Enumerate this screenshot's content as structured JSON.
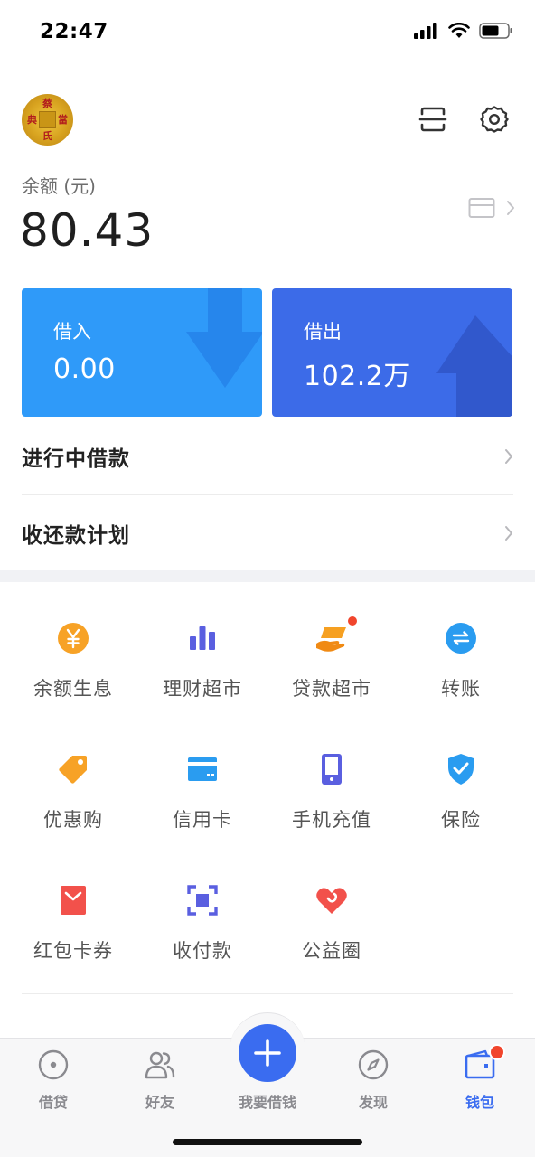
{
  "status_bar": {
    "time": "22:47"
  },
  "header": {
    "avatar_chars": [
      "蔡",
      "典",
      "當",
      "氏"
    ]
  },
  "balance": {
    "label": "余额 (元)",
    "value": "80.43"
  },
  "tiles": {
    "borrow": {
      "label": "借入",
      "value": "0.00",
      "color": "#2f9af9"
    },
    "lend": {
      "label": "借出",
      "value": "102.2万",
      "color": "#3c6be8"
    }
  },
  "list": [
    {
      "label": "进行中借款"
    },
    {
      "label": "收还款计划"
    }
  ],
  "grid": [
    {
      "label": "余额生息",
      "icon": "yen-coin-icon"
    },
    {
      "label": "理财超市",
      "icon": "bar-chart-icon"
    },
    {
      "label": "贷款超市",
      "icon": "hand-money-icon",
      "badge": true
    },
    {
      "label": "转账",
      "icon": "transfer-icon"
    },
    {
      "label": "优惠购",
      "icon": "tag-icon"
    },
    {
      "label": "信用卡",
      "icon": "credit-card-icon"
    },
    {
      "label": "手机充值",
      "icon": "phone-icon"
    },
    {
      "label": "保险",
      "icon": "shield-check-icon"
    },
    {
      "label": "红包卡券",
      "icon": "red-envelope-icon"
    },
    {
      "label": "收付款",
      "icon": "scan-icon"
    },
    {
      "label": "公益圈",
      "icon": "heart-icon"
    }
  ],
  "tab_bar": {
    "items": [
      {
        "label": "借贷",
        "icon": "loan-icon",
        "active": false
      },
      {
        "label": "好友",
        "icon": "friends-icon",
        "active": false
      },
      {
        "label": "我要借钱",
        "icon": "plus-icon",
        "active": false
      },
      {
        "label": "发现",
        "icon": "compass-icon",
        "active": false
      },
      {
        "label": "钱包",
        "icon": "wallet-icon",
        "active": true,
        "badge": true
      }
    ],
    "accent": "#3a6cf0"
  }
}
